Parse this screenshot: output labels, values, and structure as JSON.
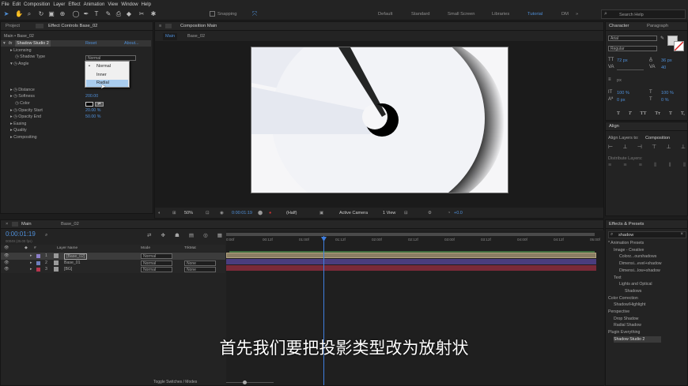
{
  "menu": [
    "File",
    "Edit",
    "Composition",
    "Layer",
    "Effect",
    "Animation",
    "View",
    "Window",
    "Help"
  ],
  "toolbar": {
    "snapping": "Snapping",
    "workspaces": [
      "Default",
      "Standard",
      "Small Screen",
      "Libraries",
      "Tutorial",
      "DM"
    ],
    "active_workspace": "Tutorial",
    "search": "Search Help"
  },
  "left_panel": {
    "tabs": [
      "Project",
      "Effect Controls Base_02"
    ],
    "breadcrumb": "Main • Base_02",
    "effect": {
      "name": "Shadow Studio 2",
      "reset": "Reset",
      "about": "About...",
      "rows": [
        "Licensing",
        "Shadow Type",
        "Angle",
        "Distance",
        "Softness",
        "Color",
        "Opacity Start",
        "Opacity End",
        "Easing",
        "Quality",
        "Compositing"
      ],
      "shadow_type_value": "Normal",
      "softness_value": "200.00",
      "opacity_start_value": "20.00 %",
      "opacity_end_value": "50.00 %"
    },
    "dropdown": {
      "options": [
        "Normal",
        "Inner",
        "Radial"
      ],
      "checked": "Normal",
      "highlighted": "Radial"
    }
  },
  "comp_panel": {
    "tab": "Composition Main",
    "sub_tabs": [
      "Main",
      "Base_02"
    ],
    "footer": {
      "zoom": "50%",
      "timecode": "0:00:01:19",
      "resolution": "(Half)",
      "camera": "Active Camera",
      "view": "1 View",
      "offset": "+0.0"
    }
  },
  "character": {
    "tabs": [
      "Character",
      "Paragraph"
    ],
    "font": "Arial",
    "style": "Regular",
    "size": "72 px",
    "leading": "36 px",
    "tracking": "40",
    "scale_v": "100 %",
    "scale_h": "100 %",
    "baseline": "0 px",
    "tsume": "0 %",
    "unit": "px",
    "buttons": [
      "T",
      "T",
      "TT",
      "Tт",
      "T",
      "T,"
    ]
  },
  "align": {
    "title": "Align",
    "align_to_label": "Align Layers to:",
    "align_to": "Composition",
    "distribute": "Distribute Layers:"
  },
  "effects_presets": {
    "title": "Effects & Presets",
    "search": "shadow",
    "items": [
      {
        "t": "* Animation Presets",
        "l": 0
      },
      {
        "t": "Image - Creative",
        "l": 1
      },
      {
        "t": "Colorz...ourshadows",
        "l": 2
      },
      {
        "t": "Dimensi...evel+shadow",
        "l": 2
      },
      {
        "t": "Dimensi...low+shadow",
        "l": 2
      },
      {
        "t": "Text",
        "l": 1
      },
      {
        "t": "Lights and Optical",
        "l": 2
      },
      {
        "t": "Shadows",
        "l": 3
      },
      {
        "t": "Color Correction",
        "l": 0
      },
      {
        "t": "Shadow/Highlight",
        "l": 1
      },
      {
        "t": "Perspective",
        "l": 0
      },
      {
        "t": "Drop Shadow",
        "l": 1
      },
      {
        "t": "Radial Shadow",
        "l": 1
      },
      {
        "t": "Plugin Everything",
        "l": 0
      },
      {
        "t": "Shadow Studio 2",
        "l": 1
      }
    ]
  },
  "timeline": {
    "tabs": [
      "Main",
      "Base_02"
    ],
    "timecode": "0:00:01:19",
    "fps": "00049 (25.00 fps)",
    "headers": {
      "layer_name": "Layer Name",
      "mode": "Mode",
      "trkmat": "TrkMat"
    },
    "ticks": [
      "0:00f",
      "00:12f",
      "01:00f",
      "01:12f",
      "02:00f",
      "02:12f",
      "03:00f",
      "03:12f",
      "04:00f",
      "04:12f",
      "05:00f"
    ],
    "layers": [
      {
        "num": "1",
        "name": "[Base_02]",
        "mode": "Normal",
        "trk": ""
      },
      {
        "num": "2",
        "name": "Base_01",
        "mode": "Normal",
        "trk": "None"
      },
      {
        "num": "3",
        "name": "[BG]",
        "mode": "Normal",
        "trk": "None"
      }
    ],
    "layer_colors": [
      "#8d7fc9",
      "#6e7fbd",
      "#b7354d"
    ],
    "footer": "Toggle Switches / Modes"
  },
  "subtitle": "首先我们要把投影类型改为放射状"
}
